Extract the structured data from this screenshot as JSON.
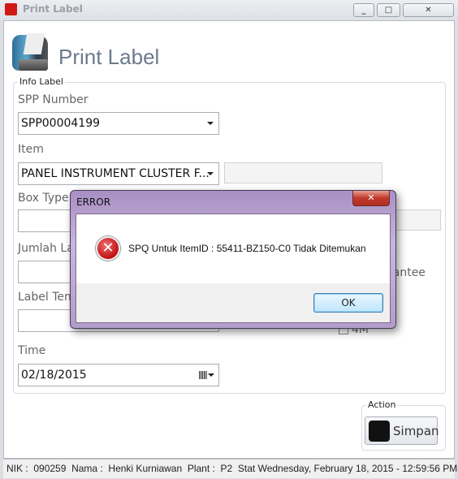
{
  "window": {
    "title": "Print Label",
    "minimize": "_",
    "maximize": "□",
    "close": "✕"
  },
  "header": {
    "title": "Print Label",
    "icon": "label-printer-icon"
  },
  "info_group": {
    "legend": "Info Label",
    "spp_label": "SPP Number",
    "spp_value": "SPP00004199",
    "item_label": "Item",
    "item_value": "PANEL INSTRUMENT CLUSTER F...",
    "item_extra": "",
    "box_type_label": "Box Type",
    "box_type_value": "",
    "jumlah_label": "Jumlah La",
    "jumlah_value": "",
    "guarantee_label": "rantee",
    "label_tem_label": "Label Tem",
    "label_tem_value": "",
    "checkbox_4m": "4M",
    "time_label": "Time",
    "time_value": "02/18/2015"
  },
  "action_group": {
    "legend": "Action",
    "save_label": "Simpan"
  },
  "status": {
    "nik_label": "NIK :",
    "nik": "090259",
    "nama_label": "Nama :",
    "nama": "Henki Kurniawan",
    "plant_label": "Plant :",
    "plant": "P2",
    "stat_label": "Stat",
    "stat": "Wednesday, February 18, 2015 - 12:59:56 PM"
  },
  "dialog": {
    "title": "ERROR",
    "message": "SPQ Untuk ItemID : 55411-BZ150-C0 Tidak Ditemukan",
    "ok": "OK",
    "close": "✕",
    "icon": "error-icon"
  }
}
